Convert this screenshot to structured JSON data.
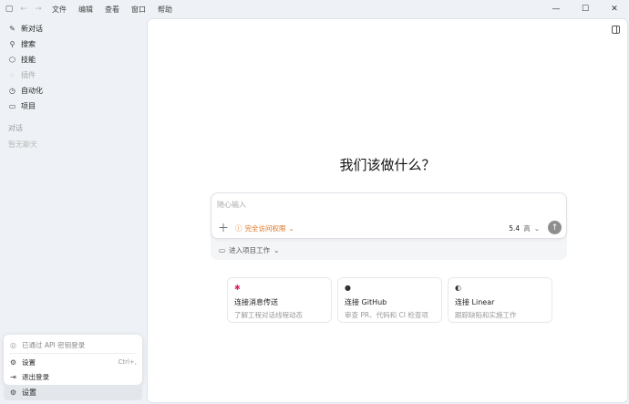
{
  "window": {
    "menu": [
      "文件",
      "编辑",
      "查看",
      "窗口",
      "帮助"
    ]
  },
  "sidebar": {
    "items": [
      {
        "label": "新对话",
        "icon": "edit-icon",
        "disabled": false
      },
      {
        "label": "搜索",
        "icon": "search-icon",
        "disabled": false
      },
      {
        "label": "技能",
        "icon": "cube-icon",
        "disabled": false
      },
      {
        "label": "插件",
        "icon": "plugin-icon",
        "disabled": true
      },
      {
        "label": "自动化",
        "icon": "clock-icon",
        "disabled": false
      },
      {
        "label": "项目",
        "icon": "folder-icon",
        "disabled": false
      }
    ],
    "section_label": "对话",
    "empty_label": "暂无聊天"
  },
  "account_menu": {
    "login_status": "已通过 API 密钥登录",
    "settings_label": "设置",
    "settings_shortcut": "Ctrl+,",
    "logout_label": "退出登录"
  },
  "settings_button": {
    "label": "设置"
  },
  "main": {
    "headline": "我们该做什么？",
    "composer": {
      "placeholder": "随心输入",
      "value": "",
      "access_label": "完全访问权限",
      "model_version": "5.4",
      "model_effort": "高"
    },
    "project_label": "进入项目工作",
    "cards": [
      {
        "icon": "slack-icon",
        "title": "连接消息传送",
        "desc": "了解工程对话线程动态"
      },
      {
        "icon": "github-icon",
        "title": "连接 GitHub",
        "desc": "审查 PR、代码和 CI 检查项"
      },
      {
        "icon": "linear-icon",
        "title": "连接 Linear",
        "desc": "跟踪缺陷和实施工作"
      }
    ]
  },
  "colors": {
    "accent_warning": "#d9701e",
    "send_button": "#8e8e8e",
    "sidebar_bg": "#eef1f5"
  }
}
